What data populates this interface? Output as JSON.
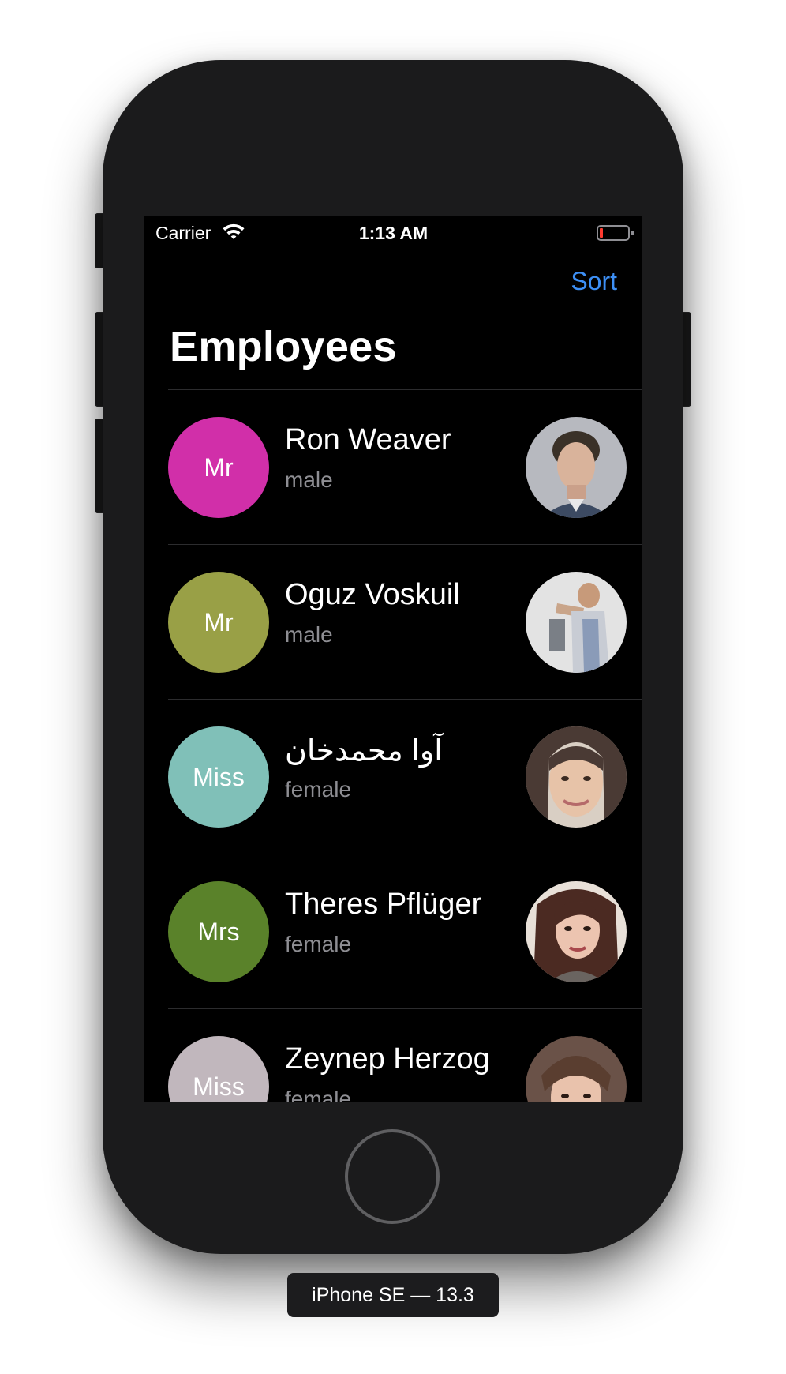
{
  "status_bar": {
    "carrier": "Carrier",
    "time": "1:13 AM",
    "wifi_icon": "wifi-icon",
    "battery_icon": "battery-low-icon"
  },
  "nav": {
    "sort_label": "Sort",
    "title": "Employees",
    "accent_color": "#3d8ff5"
  },
  "employees": [
    {
      "title": "Mr",
      "name": "Ron Weaver",
      "gender": "male",
      "circle_color": "#d12fa9",
      "photo_icon": "user-photo"
    },
    {
      "title": "Mr",
      "name": "Oguz Voskuil",
      "gender": "male",
      "circle_color": "#99a046",
      "photo_icon": "user-photo"
    },
    {
      "title": "Miss",
      "name": "آوا محمدخان",
      "gender": "female",
      "circle_color": "#80c0b8",
      "photo_icon": "user-photo"
    },
    {
      "title": "Mrs",
      "name": "Theres Pflüger",
      "gender": "female",
      "circle_color": "#5a822a",
      "photo_icon": "user-photo"
    },
    {
      "title": "Miss",
      "name": "Zeynep Herzog",
      "gender": "female",
      "circle_color": "#c1b7bd",
      "photo_icon": "user-photo"
    }
  ],
  "device_label": "iPhone SE — 13.3"
}
